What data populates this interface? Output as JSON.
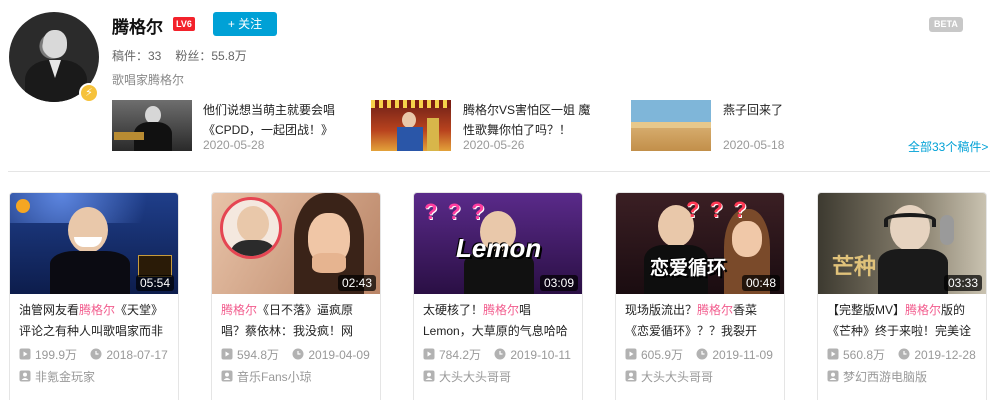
{
  "profile": {
    "name": "腾格尔",
    "level": "LV6",
    "follow_label": "+ 关注",
    "beta_label": "BETA",
    "videos_stat": "稿件：33",
    "fans_stat": "粉丝：55.8万",
    "signature": "歌唱家腾格尔",
    "verify_icon": "lightning-icon"
  },
  "recent": [
    {
      "title": "他们说想当萌主就要会唱《CPDD，一起团战！》",
      "date": "2020-05-28"
    },
    {
      "title": "腾格尔VS害怕区一姐 魔性歌舞你怕了吗？！",
      "date": "2020-05-26"
    },
    {
      "title": "燕子回来了",
      "date": "2020-05-18"
    }
  ],
  "all_link": "全部33个稿件>",
  "cards": [
    {
      "pre": "油管网友看",
      "hl": "腾格尔",
      "post": "《天堂》评论之有种人叫歌唱家而非",
      "duration": "05:54",
      "views": "199.9万",
      "date": "2018-07-17",
      "uploader": "非氪金玩家"
    },
    {
      "pre": "",
      "hl": "腾格尔",
      "post": "《日不落》逼疯原唱？蔡依林：我没疯！网",
      "duration": "02:43",
      "views": "594.8万",
      "date": "2019-04-09",
      "uploader": "音乐Fans小琼"
    },
    {
      "pre": "太硬核了！",
      "hl": "腾格尔",
      "post": "唱Lemon，大草原的气息哈哈",
      "duration": "03:09",
      "views": "784.2万",
      "date": "2019-10-11",
      "uploader": "大头大头哥哥"
    },
    {
      "pre": "现场版流出？",
      "hl": "腾格尔",
      "post": "香菜《恋爱循环》？？我裂开",
      "duration": "00:48",
      "views": "605.9万",
      "date": "2019-11-09",
      "uploader": "大头大头哥哥"
    },
    {
      "pre": "【完整版MV】",
      "hl": "腾格尔",
      "post": "版的《芒种》终于来啦！完美诠",
      "duration": "03:33",
      "views": "560.8万",
      "date": "2019-12-28",
      "uploader": "梦幻西游电脑版"
    }
  ],
  "thumb_overlays": {
    "lemon": "Lemon",
    "lianai": "恋爱循环",
    "mangzhong": "芒种",
    "qmarks": "? ? ?"
  },
  "colors": {
    "accent": "#00a1d6",
    "highlight": "#f25d8e",
    "level": "#f3222b"
  }
}
